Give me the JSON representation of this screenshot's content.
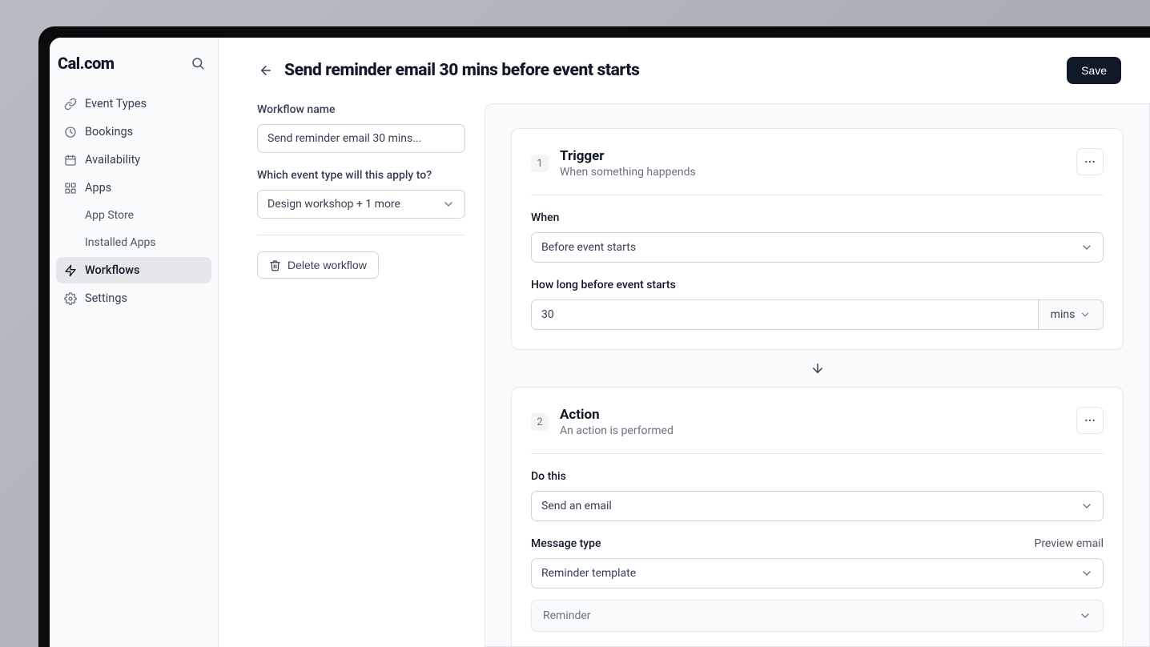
{
  "brand": "Cal.com",
  "sidebar": {
    "items": [
      {
        "label": "Event Types"
      },
      {
        "label": "Bookings"
      },
      {
        "label": "Availability"
      },
      {
        "label": "Apps"
      },
      {
        "label": "App Store"
      },
      {
        "label": "Installed Apps"
      },
      {
        "label": "Workflows"
      },
      {
        "label": "Settings"
      }
    ]
  },
  "header": {
    "title": "Send reminder email 30 mins before event starts",
    "save": "Save"
  },
  "form": {
    "name_label": "Workflow name",
    "name_value": "Send reminder email 30 mins...",
    "apply_label": "Which event type will this apply to?",
    "apply_value": "Design workshop + 1 more",
    "delete_label": "Delete workflow"
  },
  "trigger": {
    "step": "1",
    "title": "Trigger",
    "subtitle": "When something happends",
    "when_label": "When",
    "when_value": "Before event starts",
    "howlong_label": "How long before event starts",
    "howlong_value": "30",
    "unit": "mins"
  },
  "action": {
    "step": "2",
    "title": "Action",
    "subtitle": "An action is performed",
    "do_label": "Do this",
    "do_value": "Send an email",
    "msg_label": "Message type",
    "msg_value": "Reminder template",
    "preview": "Preview email",
    "extra": "Reminder"
  }
}
